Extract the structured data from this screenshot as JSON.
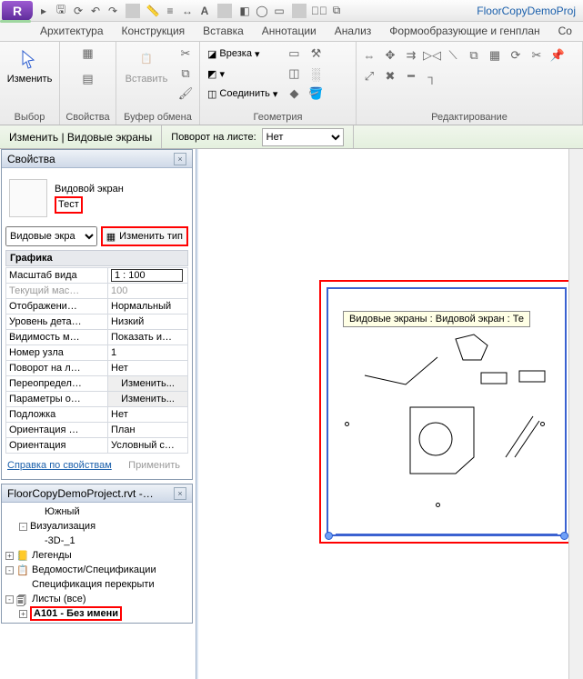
{
  "app": {
    "title": "FloorCopyDemoProj"
  },
  "tabs": {
    "arch": "Архитектура",
    "struct": "Конструкция",
    "insert": "Вставка",
    "annot": "Аннотации",
    "analysis": "Анализ",
    "massing": "Формообразующие и генплан",
    "coll": "Со"
  },
  "ribbon": {
    "modify": {
      "label": "Изменить",
      "group": "Выбор"
    },
    "props": {
      "group": "Свойства"
    },
    "paste": {
      "label": "Вставить",
      "group": "Буфер обмена"
    },
    "geometry": {
      "cut": "Врезка",
      "join": "Соединить",
      "group": "Геометрия"
    },
    "edit": {
      "group": "Редактирование"
    }
  },
  "optbar": {
    "context": "Изменить | Видовые экраны",
    "rotation_label": "Поворот на листе:",
    "rotation_value": "Нет"
  },
  "properties": {
    "panel_title": "Свойства",
    "type_family": "Видовой экран",
    "type_name": "Тест",
    "selector": "Видовые экра",
    "edit_type": "Изменить тип",
    "category": "Графика",
    "rows": {
      "scale": {
        "l": "Масштаб вида",
        "v": "1 : 100"
      },
      "scale2": {
        "l": "Текущий мас…",
        "v": "100"
      },
      "display": {
        "l": "Отображени…",
        "v": "Нормальный"
      },
      "detail": {
        "l": "Уровень дета…",
        "v": "Низкий"
      },
      "visibility": {
        "l": "Видимость м…",
        "v": "Показать и…"
      },
      "node": {
        "l": "Номер узла",
        "v": "1"
      },
      "rot": {
        "l": "Поворот на л…",
        "v": "Нет"
      },
      "override": {
        "l": "Переопредел…",
        "v": "Изменить..."
      },
      "params": {
        "l": "Параметры о…",
        "v": "Изменить..."
      },
      "underlay": {
        "l": "Подложка",
        "v": "Нет"
      },
      "under_o": {
        "l": "Ориентация …",
        "v": "План"
      },
      "orient": {
        "l": "Ориентация",
        "v": "Условный с…"
      }
    },
    "help": "Справка по свойствам",
    "apply": "Применить"
  },
  "browser": {
    "title": "FloorCopyDemoProject.rvt -…",
    "items": {
      "south": "Южный",
      "viz": "Визуализация",
      "v3d": "-3D-_1",
      "legends": "Легенды",
      "schedules": "Ведомости/Спецификации",
      "sched1": "Спецификация перекрыти",
      "sheets": "Листы (все)",
      "sheet1": "А101 - Без имени"
    }
  },
  "canvas": {
    "tooltip": "Видовые экраны : Видовой экран : Те"
  }
}
